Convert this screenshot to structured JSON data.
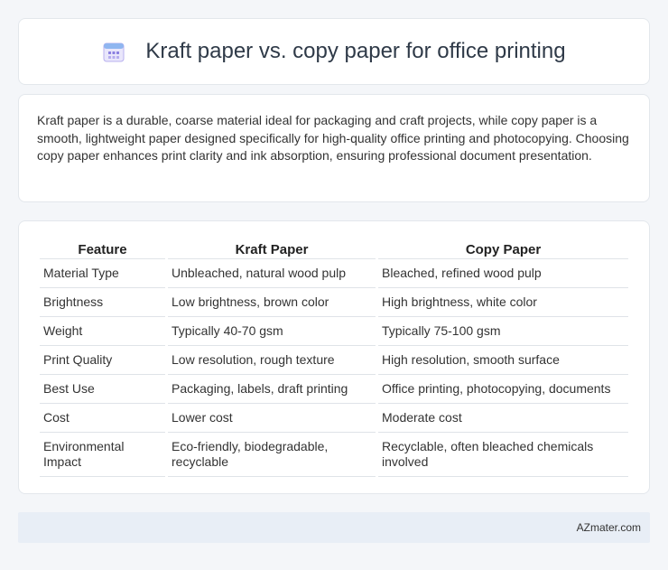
{
  "header": {
    "icon": "calendar-icon",
    "title": "Kraft paper vs. copy paper for office printing"
  },
  "intro": {
    "text": "Kraft paper is a durable, coarse material ideal for packaging and craft projects, while copy paper is a smooth, lightweight paper designed specifically for high-quality office printing and photocopying. Choosing copy paper enhances print clarity and ink absorption, ensuring professional document presentation."
  },
  "table": {
    "headers": [
      "Feature",
      "Kraft Paper",
      "Copy Paper"
    ],
    "rows": [
      [
        "Material Type",
        "Unbleached, natural wood pulp",
        "Bleached, refined wood pulp"
      ],
      [
        "Brightness",
        "Low brightness, brown color",
        "High brightness, white color"
      ],
      [
        "Weight",
        "Typically 40-70 gsm",
        "Typically 75-100 gsm"
      ],
      [
        "Print Quality",
        "Low resolution, rough texture",
        "High resolution, smooth surface"
      ],
      [
        "Best Use",
        "Packaging, labels, draft printing",
        "Office printing, photocopying, documents"
      ],
      [
        "Cost",
        "Lower cost",
        "Moderate cost"
      ],
      [
        "Environmental Impact",
        "Eco-friendly, biodegradable, recyclable",
        "Recyclable, often bleached chemicals involved"
      ]
    ]
  },
  "footer": {
    "site": "AZmater.com"
  },
  "colors": {
    "background": "#f4f6f9",
    "card": "#ffffff",
    "footer_bg": "#e8eef6",
    "icon_accent": "#7b6fd6"
  }
}
